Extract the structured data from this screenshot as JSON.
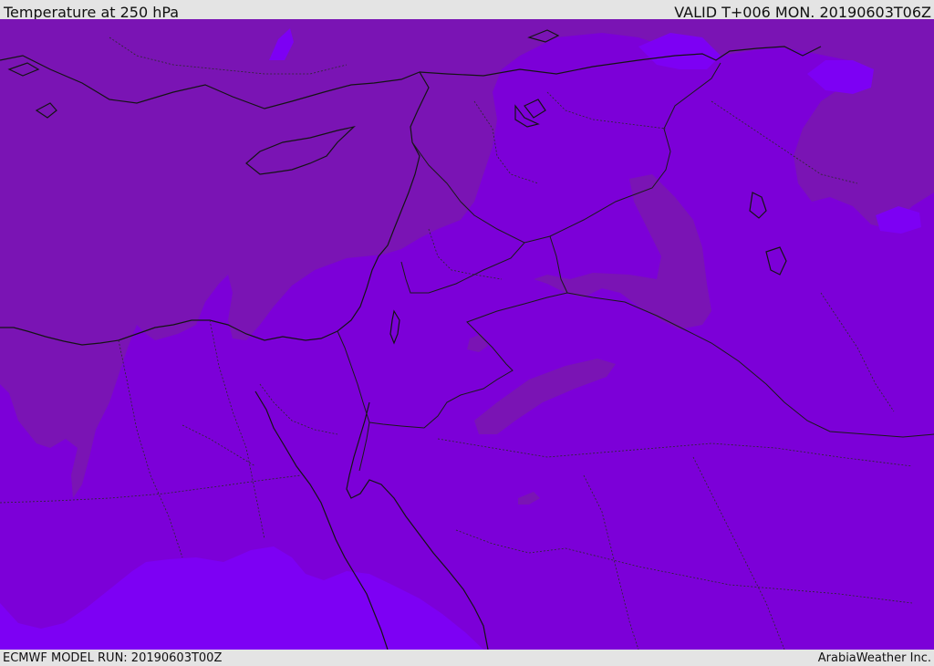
{
  "header": {
    "title": "Temperature at 250 hPa",
    "valid": "VALID T+006 MON. 20190603T06Z"
  },
  "footer": {
    "model_run": "ECMWF MODEL RUN: 20190603T00Z",
    "credit": "ArabiaWeather Inc."
  },
  "map": {
    "colors": {
      "band_cold": "#7a14b4",
      "band_mid": "#7c00d8",
      "band_warm": "#7d00f4",
      "coastline": "#141414",
      "border": "#1a1a1a",
      "province": "#2a2a2a"
    }
  }
}
